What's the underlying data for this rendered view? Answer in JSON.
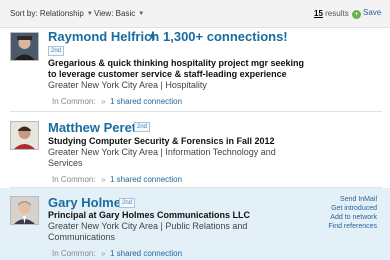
{
  "toolbar": {
    "sort_label": "Sort by:",
    "sort_value": "Relationship",
    "view_label": "View:",
    "view_value": "Basic",
    "results_count": "15",
    "results_suffix": "results",
    "save_label": "Save"
  },
  "people": [
    {
      "name": "Raymond Helfrich",
      "degree": "2nd",
      "connections": "1,300+ connections!",
      "headline_1": "Gregarious & quick thinking hospitality project mgr seeking",
      "headline_2": "to leverage customer service & staff-leading experience",
      "location_1": "Greater New York City Area | Hospitality",
      "location_2": "",
      "in_common": "In Common:",
      "plus": "»",
      "shared": "1 shared connection"
    },
    {
      "name": "Matthew Peretz",
      "degree": "2nd",
      "headline_1": "Studying Computer Security & Forensics in Fall 2012",
      "location_1": "Greater New York City Area | Information Technology and",
      "location_2": "Services",
      "in_common": "In Common:",
      "plus": "»",
      "shared": "1 shared connection"
    },
    {
      "name": "Gary Holmes",
      "degree": "2nd",
      "headline_1": "Principal at Gary Holmes Communications LLC",
      "location_1": "Greater New York City Area | Public Relations and",
      "location_2": "Communications",
      "in_common": "In Common:",
      "plus": "»",
      "shared": "1 shared connection",
      "actions": [
        "Send InMail",
        "Get introduced",
        "Add to network",
        "Find references"
      ]
    }
  ]
}
